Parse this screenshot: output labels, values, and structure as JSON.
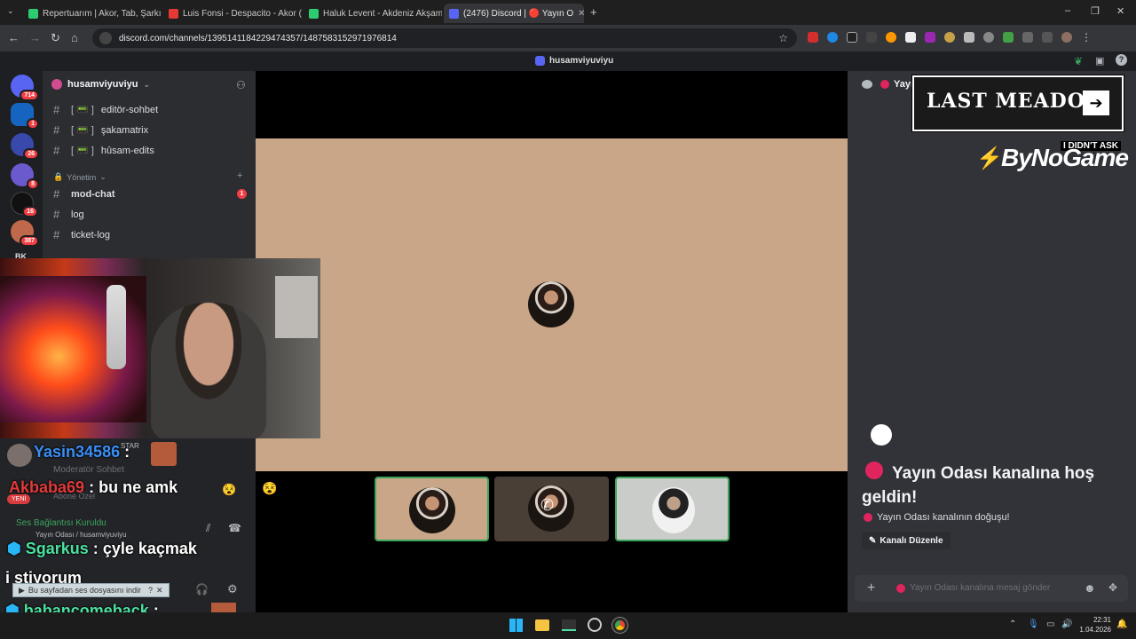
{
  "browser": {
    "tabs": [
      {
        "title": "Repertuarım | Akor, Tab, Şarkı S",
        "color": "#2ecc71"
      },
      {
        "title": "Luis Fonsi - Despacito - Akor (",
        "color": "#e53935"
      },
      {
        "title": "Haluk Levent - Akdeniz Akşamla",
        "color": "#2ecc71"
      },
      {
        "title": "(2476) Discord | 🔴 Yayın O",
        "color": "#5865f2"
      }
    ],
    "url": "discord.com/channels/1395141184229474357/1487583152971976814"
  },
  "discord": {
    "top_title": "husamviyuviyu",
    "server_name": "husamviyuviyu",
    "guild_badges": [
      "714",
      "1",
      "26",
      "8",
      "16",
      "387"
    ],
    "guild_partial_label": "BK",
    "channels": [
      {
        "name": "editör-sohbet",
        "prefix": "[ 📟 ]"
      },
      {
        "name": "şakamatrix",
        "prefix": "[ 📟 ]"
      },
      {
        "name": "hûsam-edits",
        "prefix": "[ 📟 ]"
      }
    ],
    "category": "Yönetim",
    "category_channels": [
      {
        "name": "mod-chat",
        "badge": "1"
      },
      {
        "name": "log",
        "badge": ""
      },
      {
        "name": "ticket-log",
        "badge": ""
      }
    ],
    "right_header": "Yayın",
    "welcome_title": "Yayın Odası kanalına hoş geldin!",
    "welcome_sub": "Yayın Odası kanalının doğuşu!",
    "edit_channel": "Kanalı Düzenle",
    "message_placeholder": "Yayın Odası kanalına mesaj gönder",
    "voice": {
      "status": "Ses Bağlantısı Kuruldu",
      "channel": "Yayın Odası / husamviyuviyu"
    },
    "ghost_labels": {
      "moderator": "Moderatör Sohbet",
      "abone": "Abone Özel",
      "star": "STAR",
      "yeni": "YENİ"
    }
  },
  "overlay": {
    "ad_title": "LAST MEADOW",
    "ad_caption": "I DIDN'T ASK",
    "brand": "ByNoGame",
    "download_prompt": "Bu sayfadan ses dosyasını indir",
    "chat": [
      {
        "user": "Yasin34586",
        "sep": ":",
        "message": "",
        "color": "#3a8ff7"
      },
      {
        "user": "Akbaba69",
        "sep": ":",
        "message": "bu ne amk",
        "color": "#e23a3a"
      },
      {
        "user": "Sgarkus",
        "sep": ":",
        "message": "çyle kaçmak",
        "color": "#4be1a0"
      },
      {
        "user": "",
        "sep": "",
        "message": "i stiyorum",
        "color": "#ffffff"
      },
      {
        "user": "babancomeback",
        "sep": ":",
        "message": "",
        "color": "#4be1a0"
      }
    ]
  },
  "taskbar": {
    "time": "22:31",
    "date": "1.04.2026"
  },
  "colors": {
    "stage_tile": "#c8a687",
    "discord_bg": "#313338",
    "sidebar": "#2b2d31",
    "accent_red": "#f23f43"
  }
}
